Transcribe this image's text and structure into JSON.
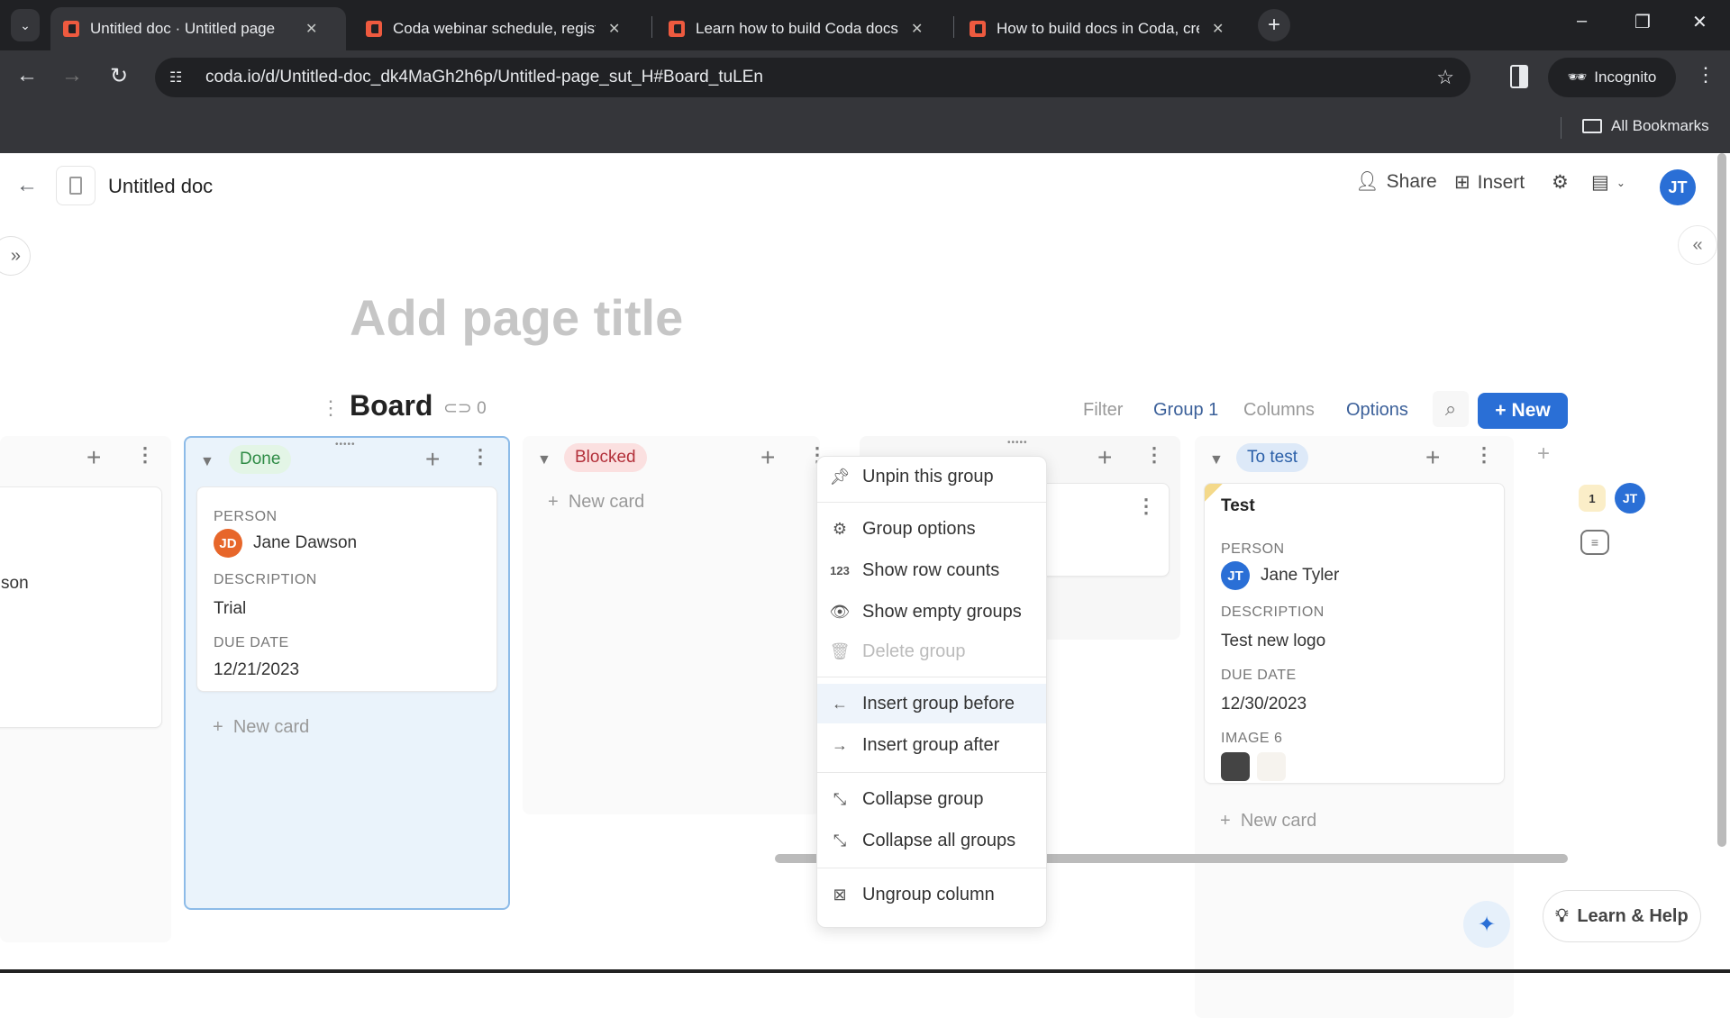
{
  "browser": {
    "tabs": [
      {
        "title": "Untitled doc · Untitled page",
        "active": true
      },
      {
        "title": "Coda webinar schedule, regist",
        "active": false
      },
      {
        "title": "Learn how to build Coda docs",
        "active": false
      },
      {
        "title": "How to build docs in Coda, cre",
        "active": false
      }
    ],
    "url": "coda.io/d/Untitled-doc_dk4MaGh2h6p/Untitled-page_sut_H#Board_tuLEn",
    "incognito_label": "Incognito",
    "bookmarks_label": "All Bookmarks"
  },
  "header": {
    "doc_title": "Untitled doc",
    "share_label": "Share",
    "insert_label": "Insert",
    "user_initials": "JT"
  },
  "page": {
    "title_placeholder": "Add page title"
  },
  "board": {
    "title": "Board",
    "link_count": "0",
    "controls": {
      "filter": "Filter",
      "group": "Group 1",
      "columns": "Columns",
      "options": "Options",
      "new": "New"
    },
    "columns": [
      {
        "label": "",
        "partial_text": "son"
      },
      {
        "label": "Done",
        "cards": [
          {
            "person_label": "PERSON",
            "person_initials": "JD",
            "person": "Jane Dawson",
            "description_label": "DESCRIPTION",
            "description": "Trial",
            "due_label": "DUE DATE",
            "due": "12/21/2023"
          }
        ],
        "new_card": "New card"
      },
      {
        "label": "Blocked",
        "new_card": "New card"
      },
      {
        "label": ""
      },
      {
        "label": "To test",
        "cards": [
          {
            "title": "Test",
            "person_label": "PERSON",
            "person_initials": "JT",
            "person": "Jane Tyler",
            "description_label": "DESCRIPTION",
            "description": "Test new logo",
            "due_label": "DUE DATE",
            "due": "12/30/2023",
            "image_label": "IMAGE 6"
          }
        ],
        "new_card": "New card"
      }
    ]
  },
  "context_menu": {
    "items": [
      {
        "label": "Unpin this group",
        "icon": "unpin-icon"
      },
      {
        "label": "Group options",
        "icon": "gear-icon"
      },
      {
        "label": "Show row counts",
        "icon": "123-icon"
      },
      {
        "label": "Show empty groups",
        "icon": "eye-icon"
      },
      {
        "label": "Delete group",
        "icon": "trash-icon",
        "disabled": true
      },
      {
        "label": "Insert group before",
        "icon": "arrow-left-icon",
        "hovered": true
      },
      {
        "label": "Insert group after",
        "icon": "arrow-right-icon"
      },
      {
        "label": "Collapse group",
        "icon": "collapse-icon"
      },
      {
        "label": "Collapse all groups",
        "icon": "collapse-icon"
      },
      {
        "label": "Ungroup column",
        "icon": "ungroup-icon"
      }
    ]
  },
  "comments": {
    "count": "1",
    "user_initials": "JT"
  },
  "help": {
    "label": "Learn & Help"
  },
  "colors": {
    "accent": "#2a6fd6",
    "done_pill_bg": "#e3f5e6",
    "done_pill_fg": "#2e8b45",
    "blocked_pill_bg": "#fbe0e0",
    "blocked_pill_fg": "#b3303a",
    "totest_pill_bg": "#dde9f8",
    "totest_pill_fg": "#2a5fa8"
  }
}
